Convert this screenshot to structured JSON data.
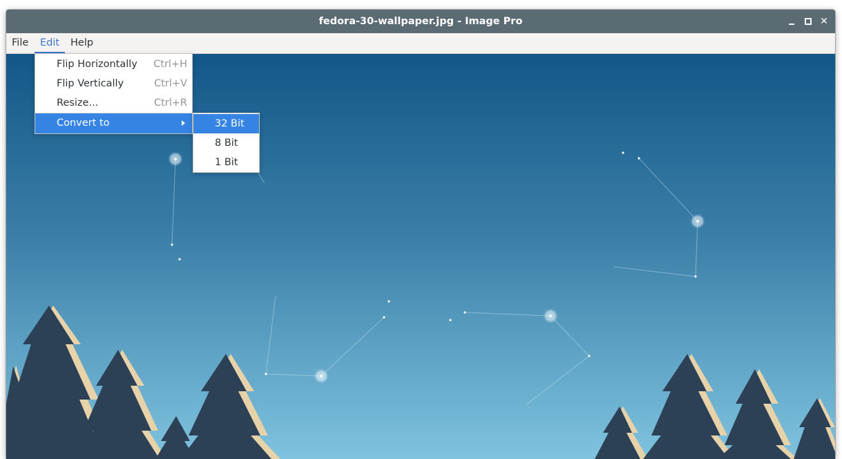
{
  "window": {
    "title": "fedora-30-wallpaper.jpg - Image Pro",
    "controls": [
      "minimize-icon",
      "maximize-icon",
      "close-icon"
    ],
    "close_glyph": "✕"
  },
  "menubar": {
    "items": [
      "File",
      "Edit",
      "Help"
    ],
    "active": "Edit"
  },
  "edit_menu": {
    "items": [
      {
        "label": "Flip Horizontally",
        "shortcut": "Ctrl+H"
      },
      {
        "label": "Flip Vertically",
        "shortcut": "Ctrl+V"
      },
      {
        "label": "Resize...",
        "shortcut": "Ctrl+R"
      },
      {
        "label": "Convert to",
        "shortcut": "",
        "submenu": true,
        "selected": true
      }
    ]
  },
  "convert_submenu": {
    "items": [
      {
        "label": "32 Bit",
        "selected": true
      },
      {
        "label": "8 Bit"
      },
      {
        "label": "1 Bit"
      }
    ]
  },
  "colors": {
    "titlebar": "#5a6b74",
    "menubar": "#f5f3f1",
    "accent": "#3584e4",
    "sky_top": "#165a8c",
    "sky_bottom": "#7cc0dd",
    "trees": "#2d4156",
    "tree_highlight": "#e8d2aa"
  }
}
